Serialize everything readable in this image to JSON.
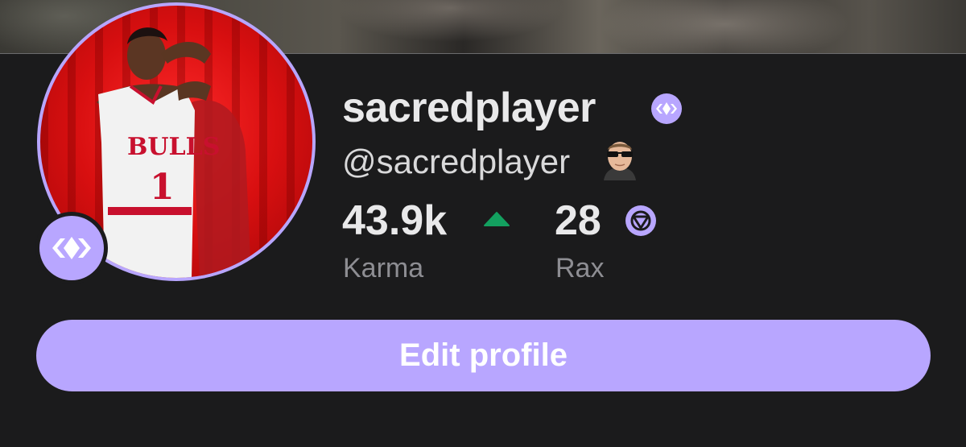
{
  "profile": {
    "display_name": "sacredplayer",
    "handle": "@sacredplayer",
    "verified_icon": "verified-diamond-icon",
    "avatar_icon": "player-avatar-image",
    "badge_icon": "diamond-badge-icon",
    "trophy_icon": "sunglasses-face-avatar"
  },
  "stats": {
    "karma": {
      "value": "43.9k",
      "label": "Karma",
      "trend": "up",
      "trend_color": "#13a05f"
    },
    "rax": {
      "value": "28",
      "label": "Rax",
      "icon": "rax-coin-icon"
    }
  },
  "actions": {
    "edit_label": "Edit profile"
  },
  "colors": {
    "accent": "#b8a6ff",
    "background": "#1b1b1c",
    "primary_text": "#e9e9ea",
    "secondary_text": "#8e8e93"
  }
}
